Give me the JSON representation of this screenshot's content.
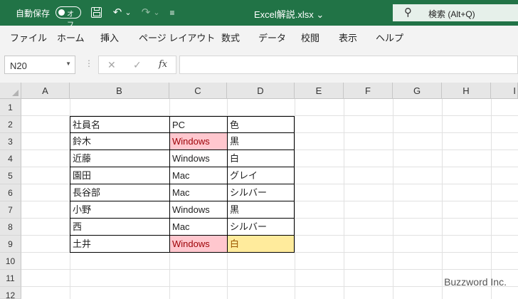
{
  "titlebar": {
    "autosave_label": "自動保存",
    "autosave_state": "オフ",
    "filename": "Excel解説.xlsx",
    "filename_caret": "⌄",
    "undo_icon": "↶",
    "redo_icon": "↷",
    "more_caret": "⌄",
    "customize_icon": "≡",
    "search_label": "検索 (Alt+Q)",
    "search_icon_glyph": "⚲",
    "accent_color": "#217346"
  },
  "ribbon": {
    "tabs": [
      "ファイル",
      "ホーム",
      "挿入",
      "ページ レイアウト",
      "数式",
      "データ",
      "校閲",
      "表示",
      "ヘルプ"
    ]
  },
  "formula_bar": {
    "name_box": "N20",
    "name_caret": "▼",
    "separator": "⋮",
    "cancel_icon": "✕",
    "enter_icon": "✓",
    "fx_label": "fx",
    "formula_value": ""
  },
  "grid": {
    "columns": [
      "A",
      "B",
      "C",
      "D",
      "E",
      "F",
      "G",
      "H",
      "I"
    ],
    "rows": [
      "1",
      "2",
      "3",
      "4",
      "5",
      "6",
      "7",
      "8",
      "9",
      "10",
      "11",
      "12"
    ],
    "table": {
      "header": [
        "社員名",
        "PC",
        "色"
      ],
      "rows": [
        [
          "鈴木",
          "Windows",
          "黒"
        ],
        [
          "近藤",
          "Windows",
          "白"
        ],
        [
          "園田",
          "Mac",
          "グレイ"
        ],
        [
          "長谷部",
          "Mac",
          "シルバー"
        ],
        [
          "小野",
          "Windows",
          "黒"
        ],
        [
          "西",
          "Mac",
          "シルバー"
        ],
        [
          "土井",
          "Windows",
          "白"
        ]
      ]
    },
    "highlight_pink": "#ffc7ce",
    "highlight_yellow": "#ffeb9c"
  },
  "watermark": "Buzzword Inc."
}
